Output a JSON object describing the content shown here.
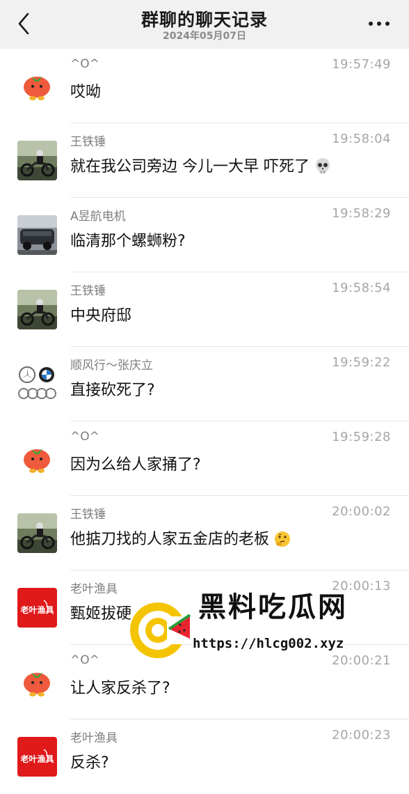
{
  "header": {
    "title": "群聊的聊天记录",
    "date": "2024年05月07日"
  },
  "messages": [
    {
      "name": "^O^",
      "time": "19:57:49",
      "text": "哎呦",
      "avatar": "tomato"
    },
    {
      "name": "王铁锤",
      "time": "19:58:04",
      "text": "就在我公司旁边 今儿一大早 吓死了",
      "avatar": "motorcycle",
      "emoji": "skull-emoji"
    },
    {
      "name": "A昱航电机",
      "time": "19:58:29",
      "text": "临清那个螺蛳粉?",
      "avatar": "car"
    },
    {
      "name": "王铁锤",
      "time": "19:58:54",
      "text": "中央府邸",
      "avatar": "motorcycle"
    },
    {
      "name": "顺风行～张庆立",
      "time": "19:59:22",
      "text": "直接砍死了?",
      "avatar": "car-logos"
    },
    {
      "name": "^O^",
      "time": "19:59:28",
      "text": "因为么给人家捅了?",
      "avatar": "tomato"
    },
    {
      "name": "王铁锤",
      "time": "20:00:02",
      "text": "他掂刀找的人家五金店的老板",
      "avatar": "motorcycle",
      "emoji": "thinking-emoji"
    },
    {
      "name": "老叶渔具",
      "time": "20:00:13",
      "text": "甄姬拔硬",
      "avatar": "fishing-logo"
    },
    {
      "name": "^O^",
      "time": "20:00:21",
      "text": "让人家反杀了?",
      "avatar": "tomato"
    },
    {
      "name": "老叶渔具",
      "time": "20:00:23",
      "text": "反杀?",
      "avatar": "fishing-logo"
    }
  ],
  "avatar_texts": {
    "fishing_logo": "老叶渔具"
  },
  "watermark": {
    "title": "黑料吃瓜网",
    "url": "https://hlcg002.xyz"
  },
  "colors": {
    "header_bg": "#f1f1f1",
    "fishing_logo_red": "#e0191b",
    "watermark_yellow": "#f5c400",
    "watermark_red": "#e8242f"
  }
}
